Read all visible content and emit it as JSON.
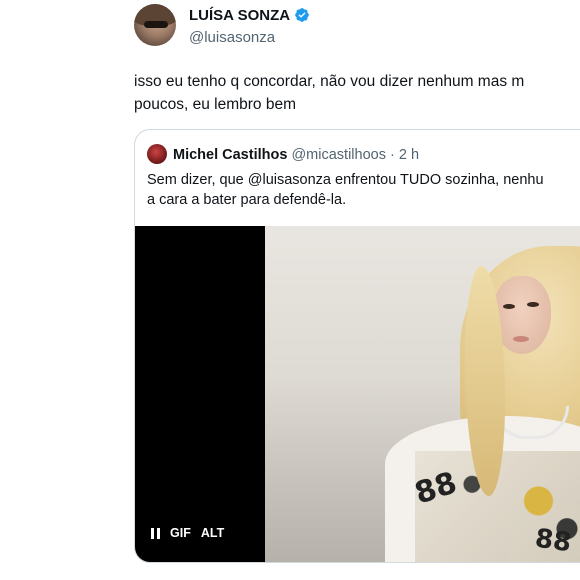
{
  "author": {
    "name": "LUÍSA SONZA",
    "handle": "@luisasonza",
    "verified_icon": "verified-badge-icon",
    "accent_color": "#1d9bf0"
  },
  "tweet": {
    "text": "isso eu tenho q concordar, não vou dizer nenhum mas m\npoucos, eu lembro bem"
  },
  "quoted_tweet": {
    "author_name": "Michel Castilhos",
    "author_handle": "@micastilhoos",
    "separator": "·",
    "time": "2 h",
    "text": "Sem dizer, que @luisasonza enfrentou TUDO sozinha, nenhu\na cara a bater para defendê-la.",
    "media": {
      "controls": {
        "pause_icon": "pause-icon",
        "gif_label": "GIF",
        "alt_label": "ALT"
      },
      "shirt_numbers": [
        "88",
        "88"
      ]
    }
  }
}
